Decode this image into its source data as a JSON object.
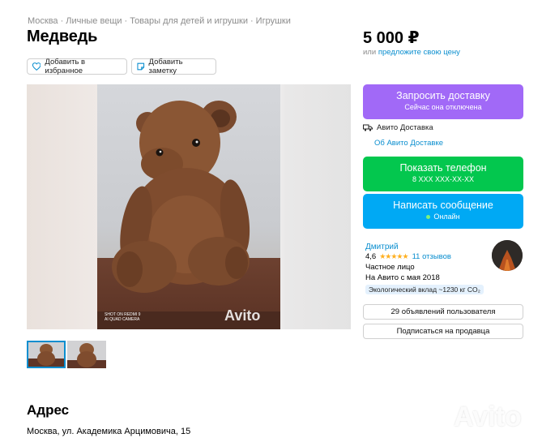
{
  "breadcrumb": [
    "Москва",
    "Личные вещи",
    "Товары для детей и игрушки",
    "Игрушки"
  ],
  "listing": {
    "title": "Медведь",
    "price": "5 000 ₽",
    "price_prefix": "или",
    "price_offer_link": "предложите свою цену"
  },
  "actions": {
    "favorite": "Добавить в избранное",
    "note": "Добавить заметку"
  },
  "photo": {
    "stamp_line1": "SHOT ON REDMI 9",
    "stamp_line2": "AI QUAD CAMERA",
    "watermark": "Avito"
  },
  "delivery": {
    "button_label": "Запросить доставку",
    "button_sub": "Сейчас она отключена",
    "service": "Авито Доставка",
    "about_link": "Об Авито Доставке"
  },
  "contact": {
    "phone_label": "Показать телефон",
    "phone_number": "8 XXX XXX-XX-XX",
    "message_label": "Написать сообщение",
    "message_status": "Онлайн"
  },
  "seller": {
    "name": "Дмитрий",
    "rating": "4,6",
    "stars": "★★★★★",
    "reviews": "11 отзывов",
    "type": "Частное лицо",
    "since": "На Авито с мая 2018",
    "eco": "Экологический вклад ~1230 кг CO₂",
    "listings_button": "29 объявлений пользователя",
    "subscribe_button": "Подписаться на продавца"
  },
  "address": {
    "title": "Адрес",
    "value": "Москва, ул. Академика Арцимовича, 15"
  },
  "colors": {
    "delivery_button": "#a169f7",
    "phone_button": "#03c74e",
    "message_button": "#00a9f4",
    "link": "#0a8ecf"
  },
  "icons": [
    "heart-icon",
    "note-icon",
    "truck-icon",
    "star-icon",
    "online-dot-icon"
  ]
}
